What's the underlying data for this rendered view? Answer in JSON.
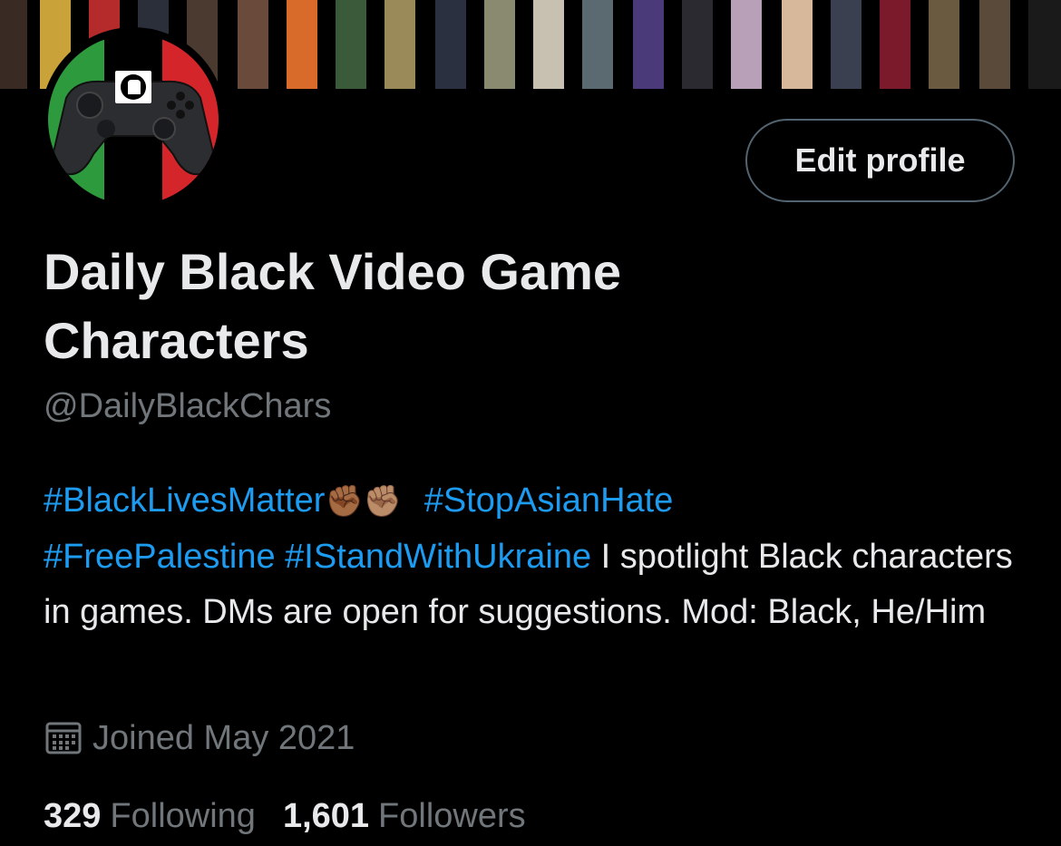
{
  "profile": {
    "display_name": "Daily Black Video Game Characters",
    "handle": "@DailyBlackChars",
    "edit_button": "Edit profile",
    "avatar_icon": "gamepad-fist-icon",
    "bio": {
      "hashtags": [
        "#BlackLivesMatter",
        "#StopAsianHate",
        "#FreePalestine",
        "#IStandWithUkraine"
      ],
      "emoji": "✊🏾✊🏽",
      "text": "I spotlight Black characters in games. DMs are open for suggestions. Mod: Black, He/Him"
    },
    "joined": "Joined May 2021",
    "following_count": "329",
    "following_label": "Following",
    "followers_count": "1,601",
    "followers_label": "Followers"
  },
  "colors": {
    "background": "#000000",
    "text": "#e7e9ea",
    "secondary": "#71767b",
    "link": "#1d9bf0",
    "button_border": "#536471"
  }
}
